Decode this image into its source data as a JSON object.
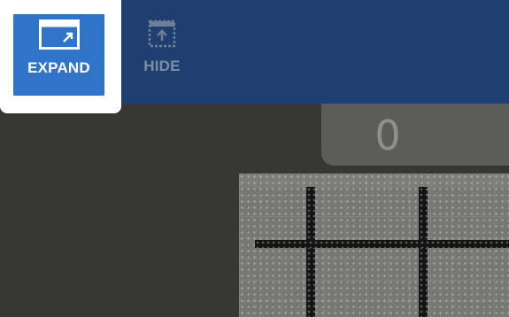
{
  "toolbar": {
    "expand_label": "EXPAND",
    "hide_label": "HIDE"
  },
  "counter": {
    "value": "0"
  },
  "colors": {
    "toolbar_bg": "#1f3f70",
    "expand_bg": "#2f74c8",
    "hide_text": "#7c8ea6",
    "background": "#373734",
    "counter_bg": "#5c5c59",
    "counter_text": "#8f8f8b"
  },
  "icons": {
    "expand": "expand-window-icon",
    "hide": "hide-panel-icon"
  }
}
